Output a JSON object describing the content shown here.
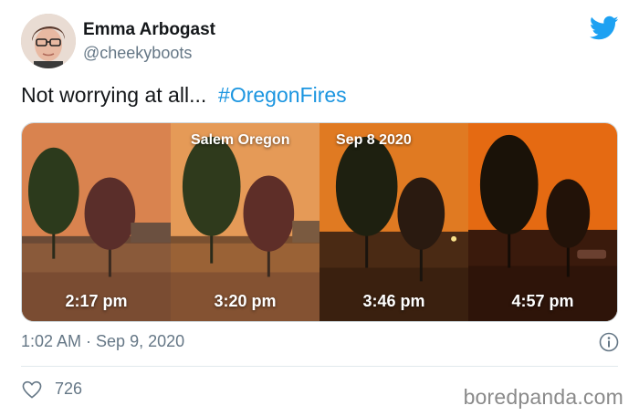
{
  "author": {
    "display_name": "Emma Arbogast",
    "handle": "@cheekyboots"
  },
  "tweet": {
    "text": "Not worrying at all...",
    "hashtag": "#OregonFires"
  },
  "media": {
    "overlay_location": "Salem Oregon",
    "overlay_date": "Sep 8 2020",
    "panels": [
      {
        "time": "2:17 pm",
        "sky_color": "#d9834f"
      },
      {
        "time": "3:20 pm",
        "sky_color": "#e59a57"
      },
      {
        "time": "3:46 pm",
        "sky_color": "#e07a22"
      },
      {
        "time": "4:57 pm",
        "sky_color": "#e56a12"
      }
    ]
  },
  "meta": {
    "timestamp": "1:02 AM · Sep 9, 2020",
    "likes": "726"
  },
  "watermark": "boredpanda.com",
  "icons": {
    "brand": "twitter-bird-icon",
    "info": "info-icon",
    "like": "heart-icon"
  },
  "colors": {
    "accent": "#1da1f2",
    "hashtag": "#1b95e0",
    "muted": "#657786"
  }
}
